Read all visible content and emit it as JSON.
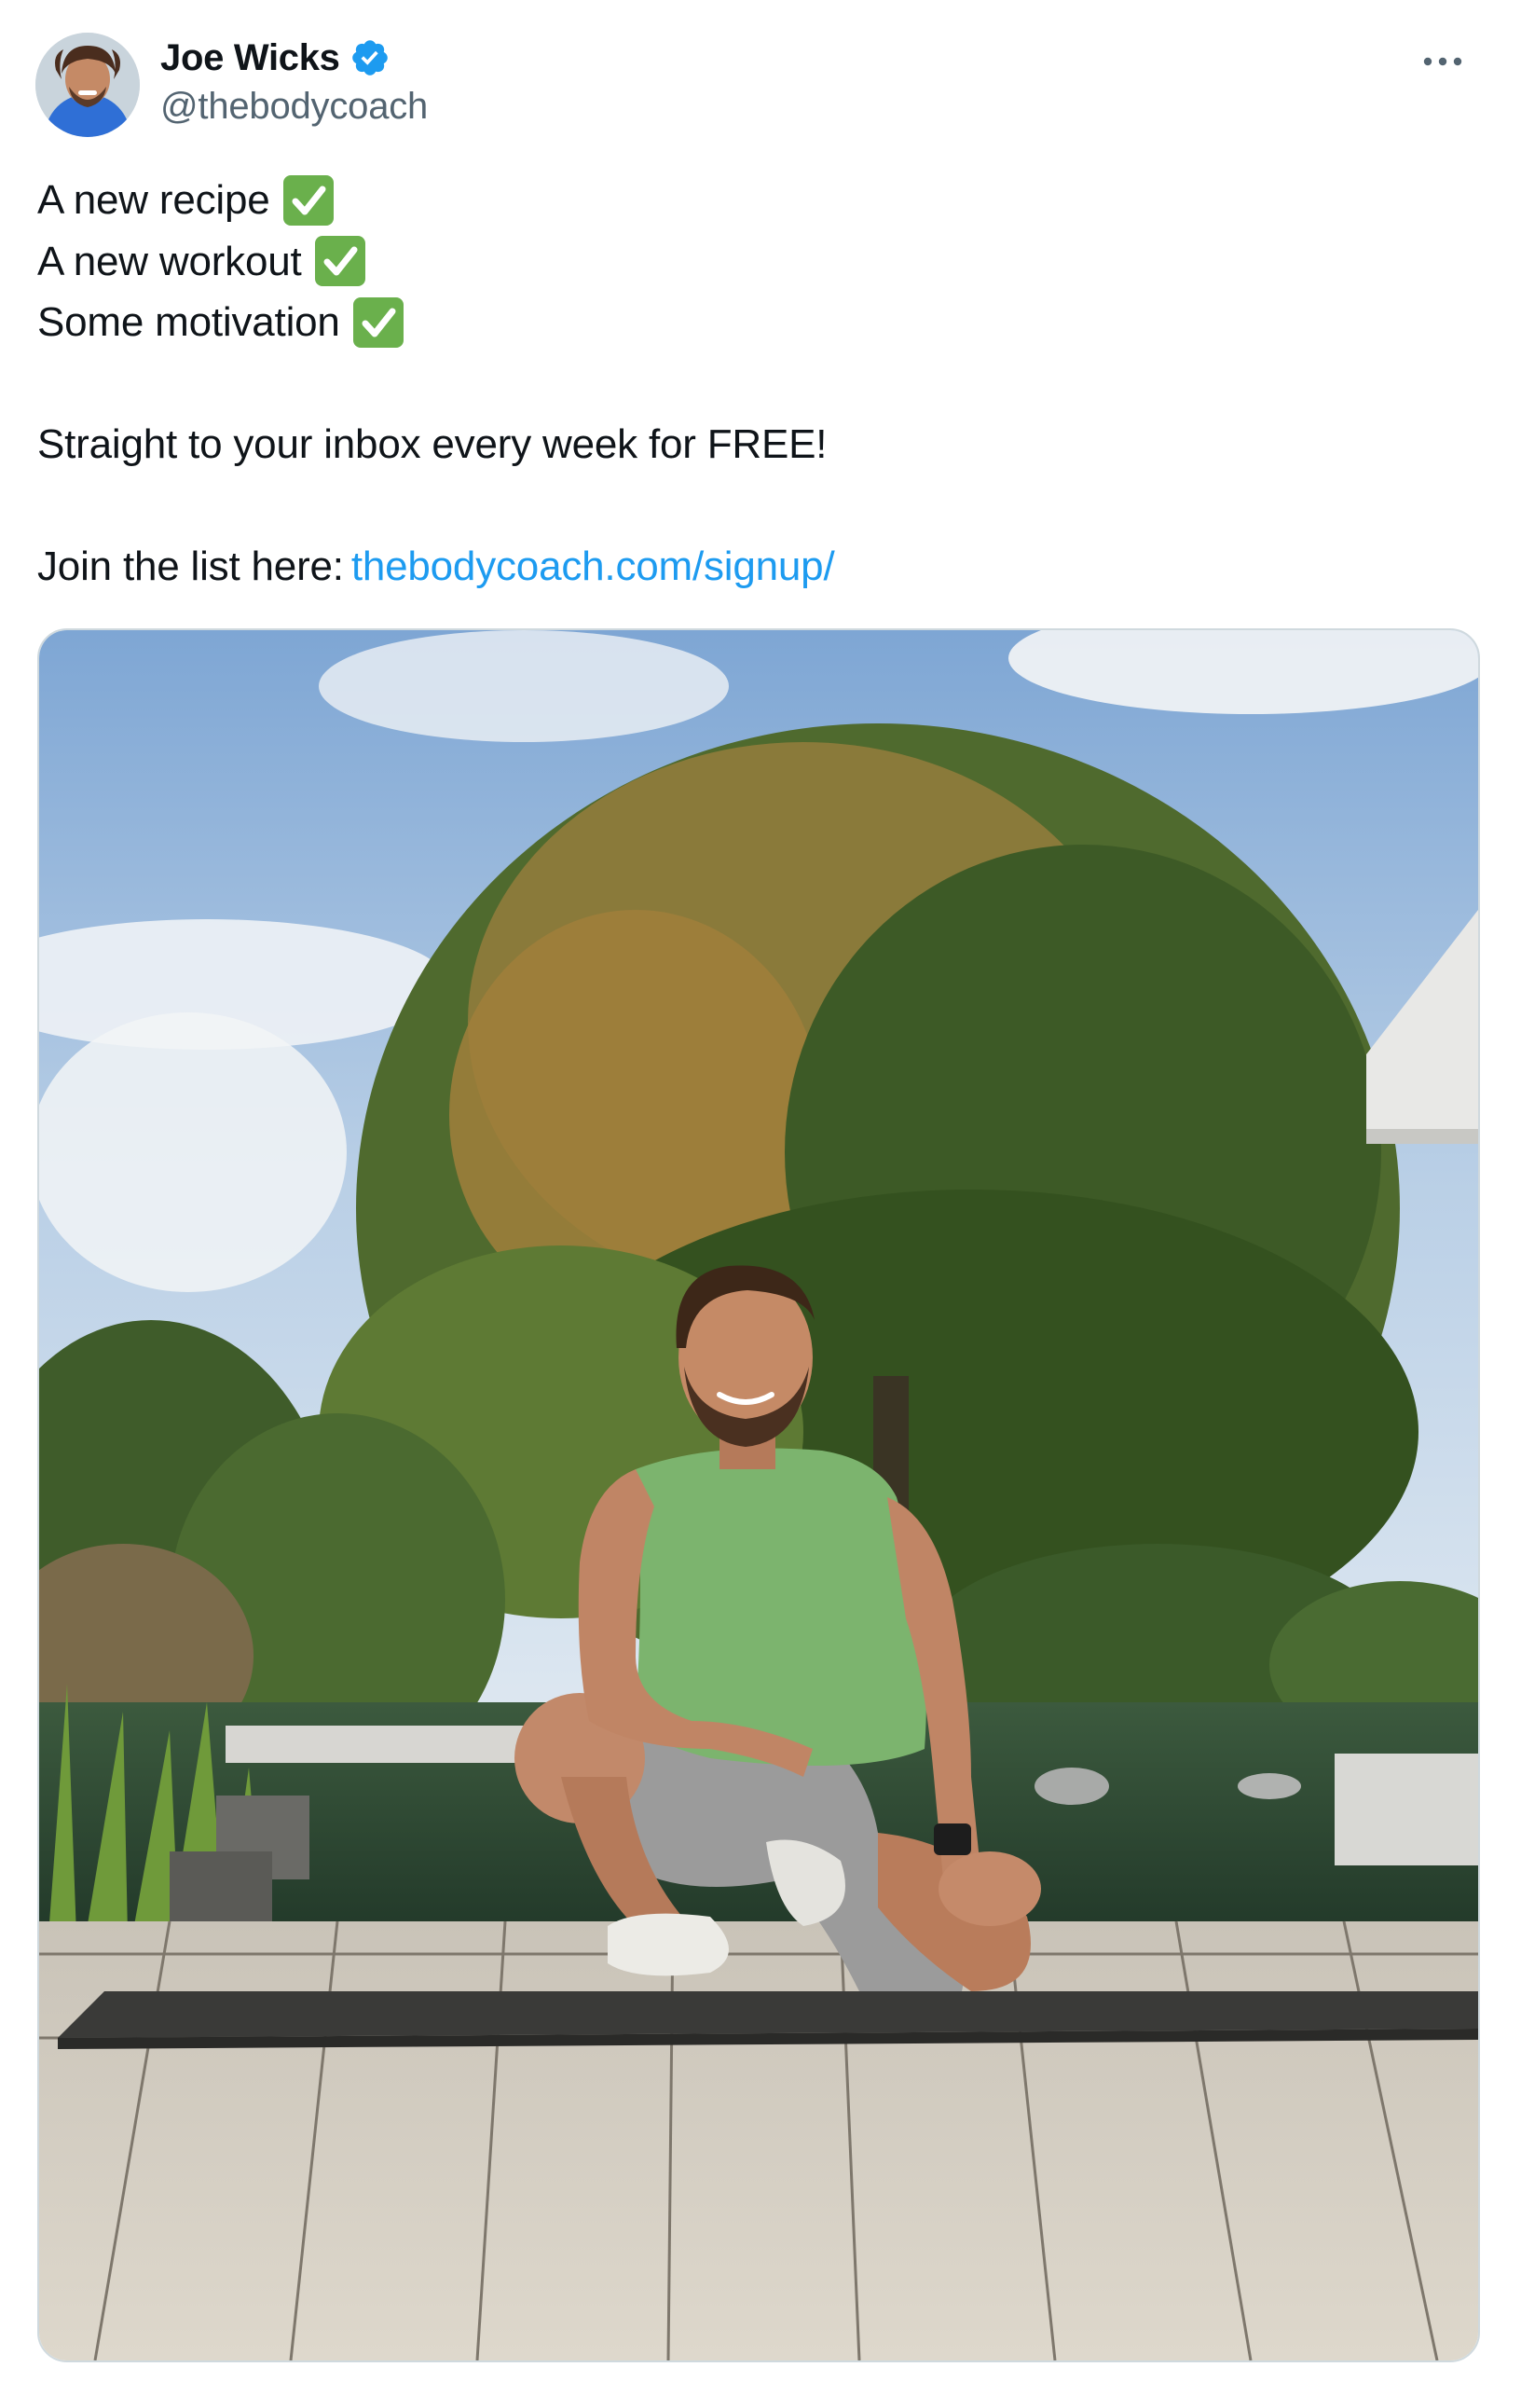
{
  "author": {
    "display_name": "Joe Wicks",
    "handle": "@thebodycoach",
    "verified": true,
    "avatar_icon": "profile-photo"
  },
  "menu_icon": "more-horizontal-icon",
  "tweet": {
    "lines": [
      {
        "text": "A new recipe",
        "emoji": "white-heavy-check-mark"
      },
      {
        "text": "A new workout",
        "emoji": "white-heavy-check-mark"
      },
      {
        "text": "Some motivation",
        "emoji": "white-heavy-check-mark"
      }
    ],
    "cta": "Straight to your inbox every week for FREE!",
    "join_prefix": "Join the list here:",
    "link_text": "thebodycoach.com/signup/"
  },
  "media": {
    "type": "photo"
  },
  "colors": {
    "link": "#1d9bf0",
    "verified_badge": "#1d9bf0",
    "check_emoji_bg": "#6ab04c",
    "handle_text": "#536471"
  }
}
